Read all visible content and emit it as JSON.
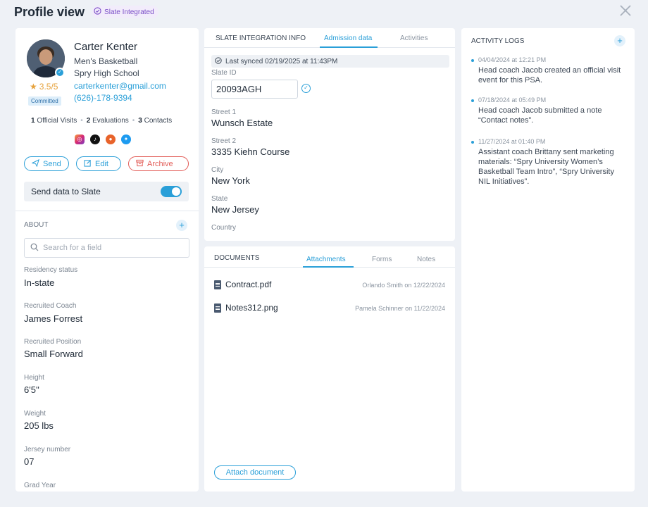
{
  "header": {
    "title": "Profile view",
    "badge": "Slate Integrated",
    "close": "×"
  },
  "profile": {
    "name": "Carter Kenter",
    "sport": "Men's Basketball",
    "school": "Spry High School",
    "email": "carterkenter@gmail.com",
    "phone": "(626)-178-9394",
    "rating": "3.5/5",
    "status": "Committed",
    "stats": [
      {
        "count": "1",
        "label": "Official Visits"
      },
      {
        "count": "2",
        "label": "Evaluations"
      },
      {
        "count": "3",
        "label": "Contacts"
      }
    ],
    "socials": [
      "instagram-icon",
      "tiktok-icon",
      "reddit-icon",
      "twitter-icon"
    ]
  },
  "actions": {
    "send": "Send",
    "edit": "Edit",
    "archive": "Archive"
  },
  "slate_toggle": {
    "label": "Send data to Slate",
    "on": true
  },
  "about": {
    "label": "ABOUT",
    "search_placeholder": "Search for a field",
    "fields": [
      {
        "label": "Residency status",
        "value": "In-state"
      },
      {
        "label": "Recruited Coach",
        "value": "James Forrest"
      },
      {
        "label": "Recruited Position",
        "value": "Small Forward"
      },
      {
        "label": "Height",
        "value": "6'5''"
      },
      {
        "label": "Weight",
        "value": "205 lbs"
      },
      {
        "label": "Jersey number",
        "value": "07"
      },
      {
        "label": "Grad Year",
        "value": ""
      }
    ]
  },
  "slate_info": {
    "tabs": [
      "SLATE INTEGRATION INFO",
      "Admission data",
      "Activities"
    ],
    "last_synced": "Last synced 02/19/2025 at 11:43PM",
    "slate_id_label": "Slate ID",
    "slate_id": "20093AGH",
    "fields": [
      {
        "label": "Street 1",
        "value": "Wunsch Estate"
      },
      {
        "label": "Street 2",
        "value": "3335 Kiehn Course"
      },
      {
        "label": "City",
        "value": "New York"
      },
      {
        "label": "State",
        "value": "New Jersey"
      },
      {
        "label": "Country",
        "value": ""
      }
    ]
  },
  "documents": {
    "tabs": [
      "DOCUMENTS",
      "Attachments",
      "Forms",
      "Notes"
    ],
    "files": [
      {
        "name": "Contract.pdf",
        "meta": "Orlando Smith on 12/22/2024"
      },
      {
        "name": "Notes312.png",
        "meta": "Pamela Schinner on 11/22/2024"
      }
    ],
    "attach_label": "Attach document"
  },
  "activity": {
    "title": "ACTIVITY LOGS",
    "logs": [
      {
        "time": "04/04/2024 at 12:21 PM",
        "text": "Head coach Jacob created an official visit event for this PSA."
      },
      {
        "time": "07/18/2024 at 05:49 PM",
        "text": "Head coach Jacob submitted a note “Contact notes”."
      },
      {
        "time": "11/27/2024 at 01:40 PM",
        "text": "Assistant coach Brittany sent marketing materials: “Spry University Women’s Basketball Team Intro”, “Spry University NIL Initiatives”."
      }
    ]
  },
  "colors": {
    "accent": "#2a9fd8",
    "danger": "#e25c57",
    "star": "#e6a23c",
    "badge_purple": "#7a4dc7"
  }
}
